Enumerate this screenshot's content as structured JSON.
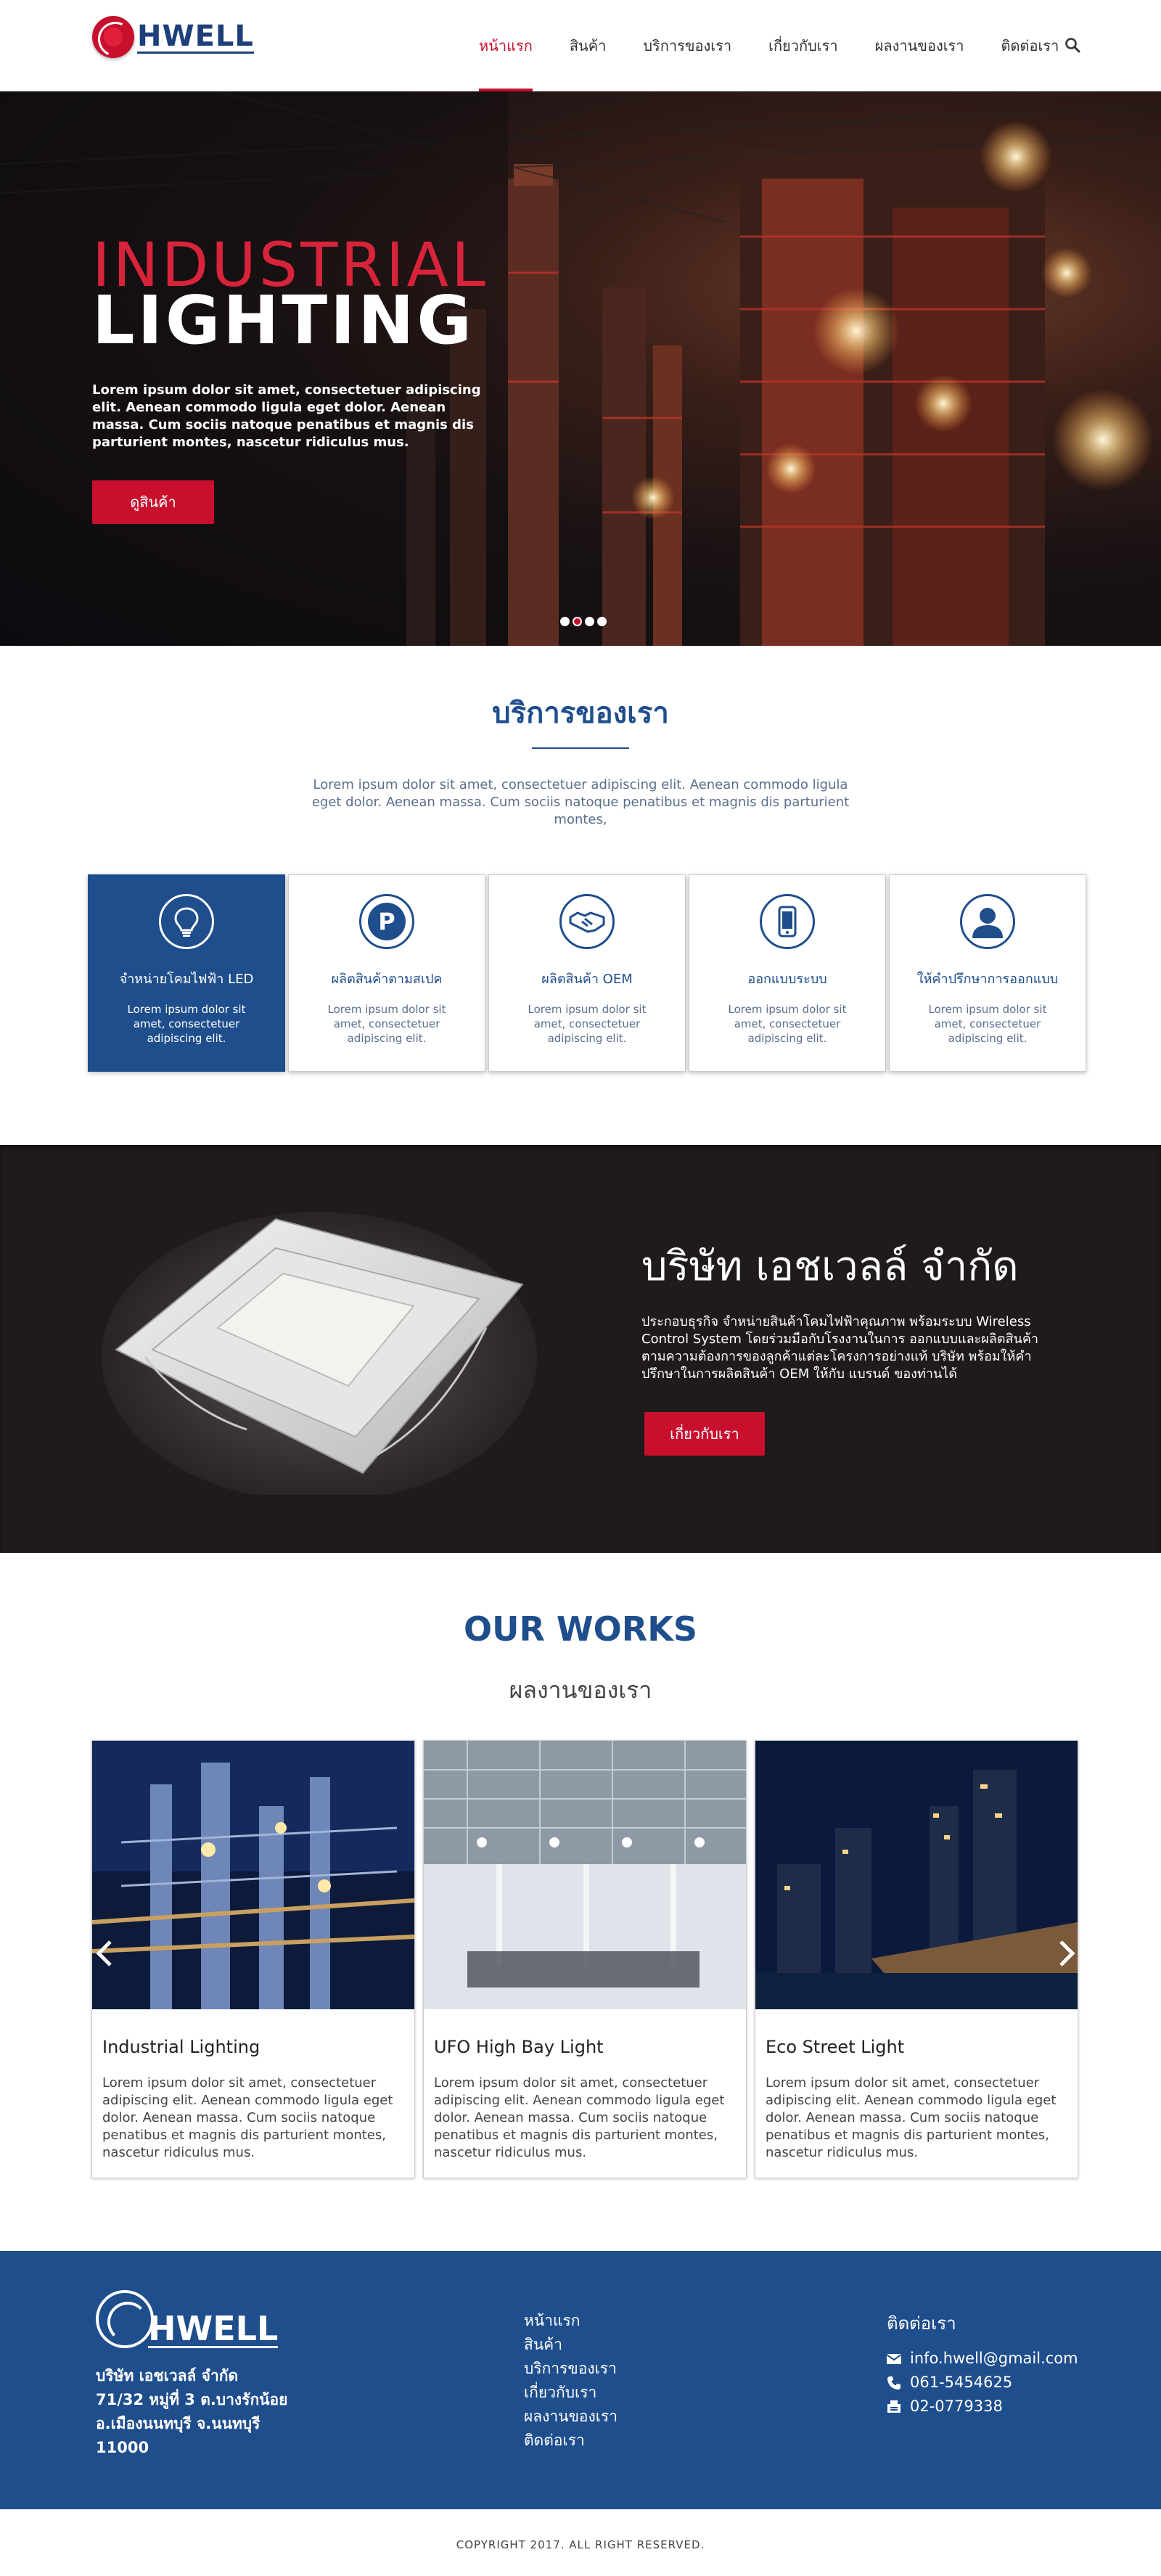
{
  "header": {
    "brand": "HWELL",
    "nav": [
      {
        "label": "หน้าแรก",
        "active": true
      },
      {
        "label": "สินค้า",
        "active": false
      },
      {
        "label": "บริการของเรา",
        "active": false
      },
      {
        "label": "เกี่ยวกับเรา",
        "active": false
      },
      {
        "label": "ผลงานของเรา",
        "active": false
      },
      {
        "label": "ติดต่อเรา",
        "active": false
      }
    ],
    "search_icon": "search-icon"
  },
  "hero": {
    "title_line1": "INDUSTRIAL",
    "title_line2": "LIGHTING",
    "text": "Lorem ipsum dolor sit amet, consectetuer adipiscing elit. Aenean commodo ligula eget dolor. Aenean massa. Cum sociis natoque penatibus et magnis dis parturient montes, nascetur ridiculus mus.",
    "button_label": "ดูสินค้า",
    "slide_count": 4,
    "active_slide": 2
  },
  "services": {
    "title": "บริการของเรา",
    "description": "Lorem ipsum dolor sit amet, consectetuer adipiscing elit. Aenean commodo ligula eget dolor. Aenean massa. Cum sociis natoque penatibus et magnis dis parturient montes,",
    "cards": [
      {
        "icon": "lightbulb-icon",
        "title": "จำหน่ายโคมไฟฟ้า LED",
        "text": "Lorem ipsum dolor sit amet, consectetuer adipiscing elit.",
        "active": true
      },
      {
        "icon": "parking-icon",
        "title": "ผลิตสินค้าตามสเปค",
        "text": "Lorem ipsum dolor sit amet, consectetuer adipiscing elit.",
        "active": false
      },
      {
        "icon": "handshake-icon",
        "title": "ผลิตสินค้า OEM",
        "text": "Lorem ipsum dolor sit amet, consectetuer adipiscing elit.",
        "active": false
      },
      {
        "icon": "smartphone-icon",
        "title": "ออกแบบระบบ",
        "text": "Lorem ipsum dolor sit amet, consectetuer adipiscing elit.",
        "active": false
      },
      {
        "icon": "user-icon",
        "title": "ให้คำปรึกษาการออกแบบ",
        "text": "Lorem ipsum dolor sit amet, consectetuer adipiscing elit.",
        "active": false
      }
    ]
  },
  "about": {
    "title": "บริษัท เอชเวลล์ จำกัด",
    "text": "ประกอบธุรกิจ จำหน่ายสินค้าโคมไฟฟ้าคุณภาพ พร้อมระบบ Wireless Control System โดยร่วมมือกับโรงงานในการ ออกแบบและผลิตสินค้าตามความต้องการของลูกค้าแต่ละโครงการอย่างแท้ บริษัท พร้อมให้คำปรึกษาในการผลิตสินค้า OEM ให้กับ แบรนด์ ของท่านได้",
    "button_label": "เกี่ยวกับเรา"
  },
  "works": {
    "title": "OUR WORKS",
    "subtitle": "ผลงานของเรา",
    "items": [
      {
        "title": "Industrial Lighting",
        "text": "Lorem ipsum dolor sit amet, consectetuer adipiscing elit. Aenean commodo ligula eget dolor. Aenean massa. Cum sociis natoque penatibus et magnis dis parturient montes, nascetur ridiculus mus."
      },
      {
        "title": "UFO High Bay Light",
        "text": "Lorem ipsum dolor sit amet, consectetuer adipiscing elit. Aenean commodo ligula eget dolor. Aenean massa. Cum sociis natoque penatibus et magnis dis parturient montes, nascetur ridiculus mus."
      },
      {
        "title": "Eco Street Light",
        "text": "Lorem ipsum dolor sit amet, consectetuer adipiscing elit. Aenean commodo ligula eget dolor. Aenean massa. Cum sociis natoque penatibus et magnis dis parturient montes, nascetur ridiculus mus."
      }
    ]
  },
  "footer": {
    "brand": "HWELL",
    "address": [
      "บริษัท เอชเวลล์ จำกัด",
      "71/32 หมู่ที่ 3 ต.บางรักน้อย",
      "อ.เมืองนนทบุรี จ.นนทบุรี",
      "11000"
    ],
    "links": [
      "หน้าแรก",
      "สินค้า",
      "บริการของเรา",
      "เกี่ยวกับเรา",
      "ผลงานของเรา",
      "ติดต่อเรา"
    ],
    "contact_title": "ติดต่อเรา",
    "email": "info.hwell@gmail.com",
    "phone": "061-5454625",
    "fax": "02-0779338",
    "copyright": "COPYRIGHT 2017. ALL RIGHT RESERVED."
  },
  "colors": {
    "brand_blue": "#1f4e8c",
    "brand_red": "#c8102e",
    "dark_band": "#1f1b1a"
  }
}
